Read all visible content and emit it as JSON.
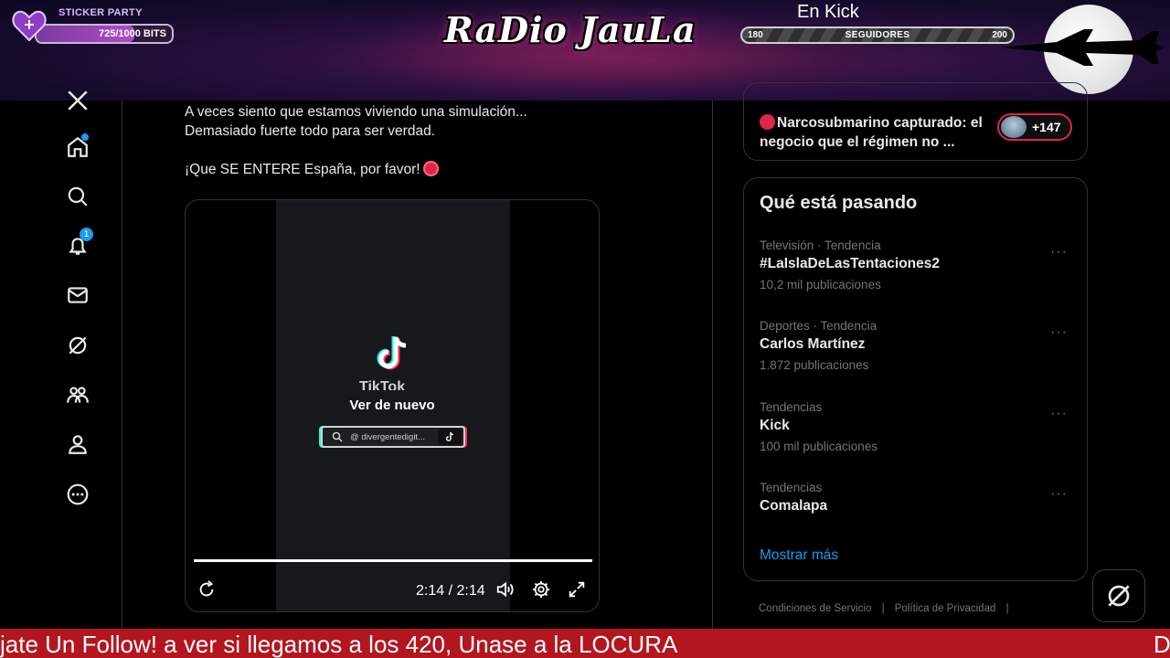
{
  "overlay": {
    "sticker_name": "STICKER PARTY",
    "sticker_bits": "725/1000 BITS",
    "sticker_progress": 0.725,
    "logo_text": "RaDio JauLa",
    "kick_label": "En Kick",
    "followers_current": "180",
    "followers_label": "SEGUIDORES",
    "followers_goal": "200"
  },
  "nav": {
    "notifications_count": "1"
  },
  "post": {
    "line1": "A veces siento que estamos viviendo una simulación...",
    "line2": "Demasiado fuerte todo para ser verdad.",
    "line3": "¡Que SE ENTERE España, por favor!",
    "video": {
      "tiktok_word": "TikTok",
      "replay_label": "Ver de nuevo",
      "search_handle": "@ divergentedigit...",
      "time": "2:14 / 2:14",
      "progress": 1.0
    }
  },
  "sidebar": {
    "news_title": "Narcosubmarino capturado: el negocio que el régimen no ...",
    "news_avatars_count": "+147",
    "trends_title": "Qué está pasando",
    "trends": [
      {
        "meta": "Televisión · Tendencia",
        "name": "#LaIslaDeLasTentaciones2",
        "count": "10,2 mil publicaciones"
      },
      {
        "meta": "Deportes · Tendencia",
        "name": "Carlos Martínez",
        "count": "1.872 publicaciones"
      },
      {
        "meta": "Tendencias",
        "name": "Kick",
        "count": "100 mil publicaciones"
      },
      {
        "meta": "Tendencias",
        "name": "Comalapa",
        "count": ""
      }
    ],
    "more_icon": "···",
    "show_more": "Mostrar más",
    "footer_terms": "Condiciones de Servicio",
    "footer_privacy": "Política de Privacidad",
    "footer_sep": "|"
  },
  "ticker": {
    "text": "jate Un Follow!  a ver si llegamos a los 420, Unase a la LOCURA",
    "text_next": "D"
  },
  "colors": {
    "accent": "#1d9bf0",
    "ticker_bg": "#b3161f",
    "red_dot": "#e0244b"
  }
}
